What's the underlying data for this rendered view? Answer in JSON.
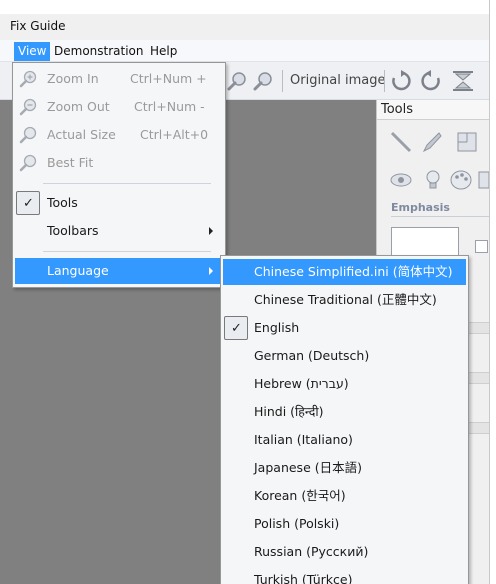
{
  "window": {
    "title": "Fix Guide"
  },
  "menubar": {
    "items": [
      "View",
      "Demonstration",
      "Help"
    ]
  },
  "toolbar": {
    "original_image_label": "Original image"
  },
  "tools_pane": {
    "title": "Tools",
    "emphasis_label": "Emphasis"
  },
  "view_menu": {
    "zoom_in": {
      "label": "Zoom In",
      "shortcut": "Ctrl+Num +"
    },
    "zoom_out": {
      "label": "Zoom Out",
      "shortcut": "Ctrl+Num -"
    },
    "actual_size": {
      "label": "Actual Size",
      "shortcut": "Ctrl+Alt+0"
    },
    "best_fit": {
      "label": "Best Fit"
    },
    "tools": {
      "label": "Tools",
      "checked": true
    },
    "toolbars": {
      "label": "Toolbars"
    },
    "language": {
      "label": "Language"
    }
  },
  "language_menu": {
    "items": [
      {
        "label": "Chinese Simplified.ini (简体中文)"
      },
      {
        "label": "Chinese Traditional (正體中文)"
      },
      {
        "label": "English",
        "checked": true
      },
      {
        "label": "German (Deutsch)"
      },
      {
        "label": "Hebrew (עברית)"
      },
      {
        "label": "Hindi (हिन्दी)"
      },
      {
        "label": "Italian (Italiano)"
      },
      {
        "label": "Japanese (日本語)"
      },
      {
        "label": "Korean (한국어)"
      },
      {
        "label": "Polish (Polski)"
      },
      {
        "label": "Russian (Русский)"
      },
      {
        "label": "Turkish (Türkçe)"
      }
    ]
  },
  "colors": {
    "highlight": "#3399ff",
    "canvas": "#808080",
    "menu_bg": "#f5f6f8"
  }
}
